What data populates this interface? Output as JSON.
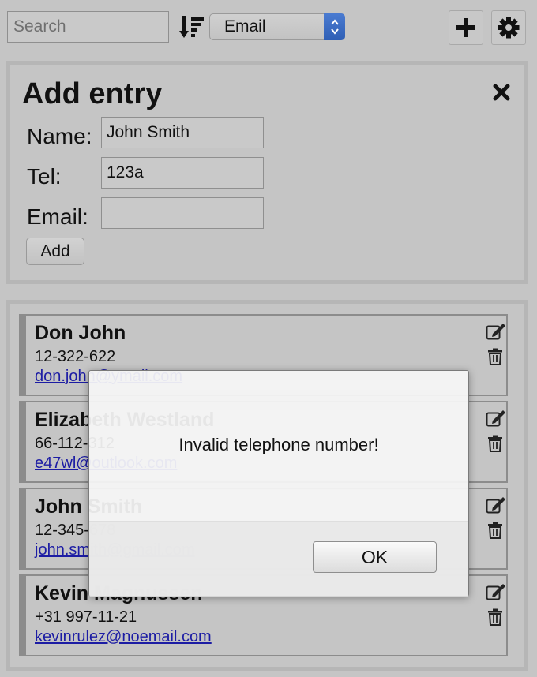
{
  "toolbar": {
    "search_placeholder": "Search",
    "sort_icon": "sort-descending-icon",
    "sort_field": "Email",
    "add_icon": "plus-icon",
    "settings_icon": "gear-icon"
  },
  "add_entry": {
    "title": "Add entry",
    "close_icon": "close-icon",
    "fields": [
      {
        "label": "Name:",
        "value": "John Smith"
      },
      {
        "label": "Tel:",
        "value": "123a"
      },
      {
        "label": "Email:",
        "value": ""
      }
    ],
    "add_button": "Add"
  },
  "contacts": [
    {
      "name": "Don John",
      "tel": "12-322-622",
      "email": "don.john@ymail.com"
    },
    {
      "name": "Elizabeth Westland",
      "tel": "66-112-312",
      "email": "e47wl@outlook.com"
    },
    {
      "name": "John Smith",
      "tel": "12-345-678",
      "email": "john.smith@gmail.com"
    },
    {
      "name": "Kevin Magnussen",
      "tel": "+31 997-11-21",
      "email": "kevinrulez@noemail.com"
    }
  ],
  "dialog": {
    "message": "Invalid telephone number!",
    "ok_label": "OK"
  },
  "colors": {
    "background": "#c5c5c5",
    "link": "#1c1ca4",
    "select_accent": "#3a6bc4"
  }
}
